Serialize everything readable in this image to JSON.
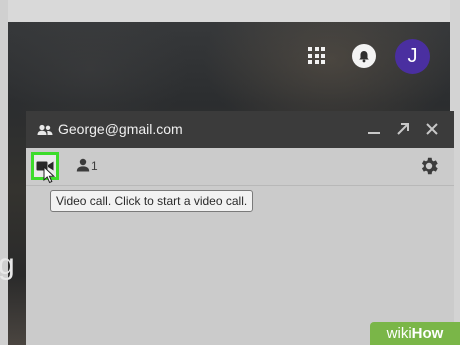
{
  "background": {
    "partial_text": "g a"
  },
  "topbar": {
    "apps_icon": "apps-grid-icon",
    "notifications_icon": "bell-icon",
    "avatar_letter": "J",
    "avatar_color": "#4a2fa0"
  },
  "chat": {
    "title": "George@gmail.com",
    "header_icons": [
      "people-icon",
      "minimize-icon",
      "popout-icon",
      "close-icon"
    ],
    "toolbar": {
      "video_icon": "video-camera-icon",
      "highlight_color": "#3ddc2b",
      "people_count": "1",
      "settings_icon": "gear-icon"
    },
    "tooltip": "Video call. Click to start a video call."
  },
  "watermark": {
    "brand_prefix": "wiki",
    "brand_suffix": "How",
    "color": "#7ab648"
  }
}
